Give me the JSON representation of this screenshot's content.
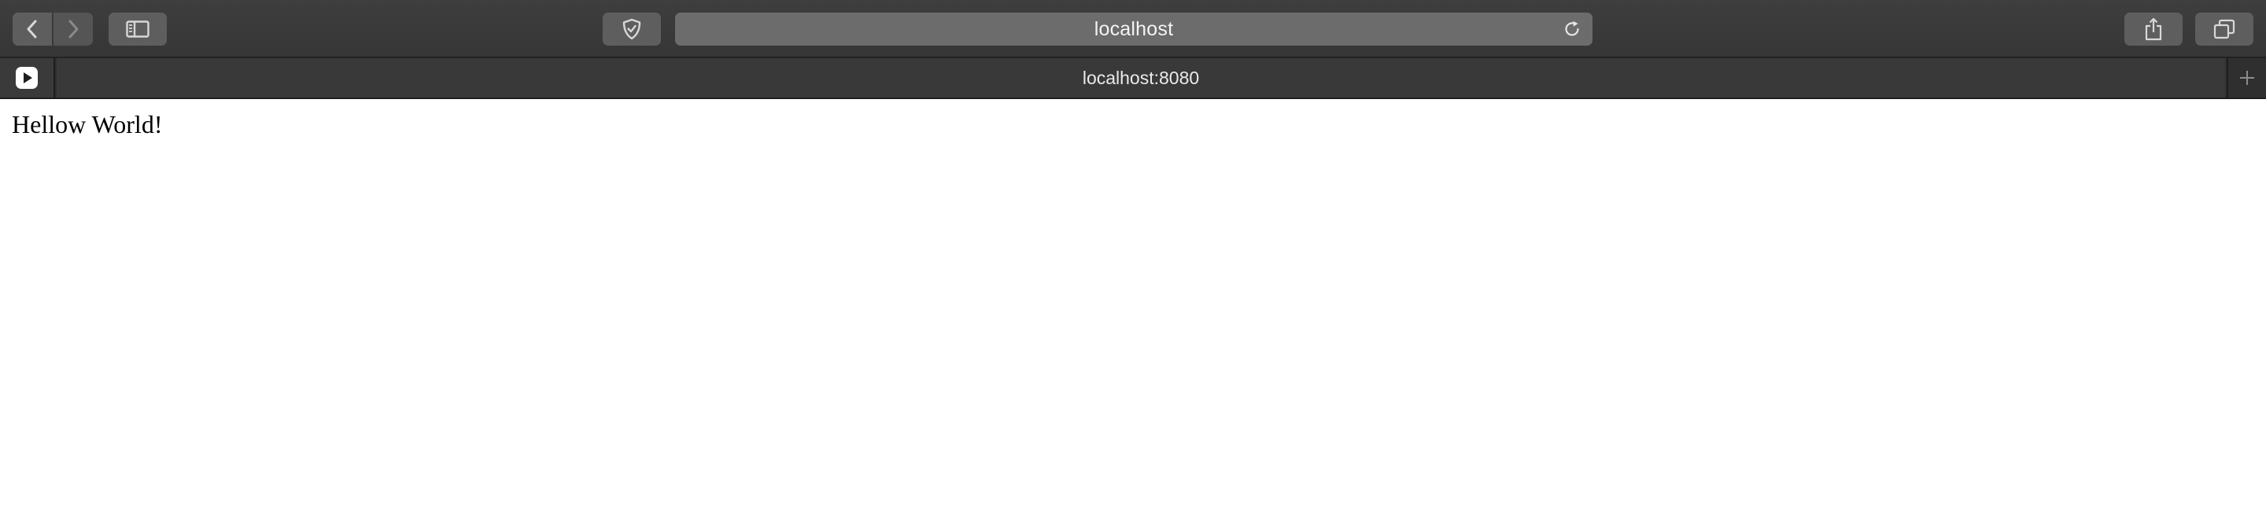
{
  "toolbar": {
    "address": "localhost"
  },
  "icons": {
    "back": "chevron-left-icon",
    "forward": "chevron-right-icon",
    "sidebar": "sidebar-icon",
    "privacy": "shield-icon",
    "reload": "reload-icon",
    "share": "share-icon",
    "tabs": "tab-overview-icon",
    "pinned": "play-icon",
    "new_tab": "plus-icon"
  },
  "tabs": [
    {
      "title": "localhost:8080",
      "active": true
    }
  ],
  "page": {
    "text": "Hellow World!"
  }
}
